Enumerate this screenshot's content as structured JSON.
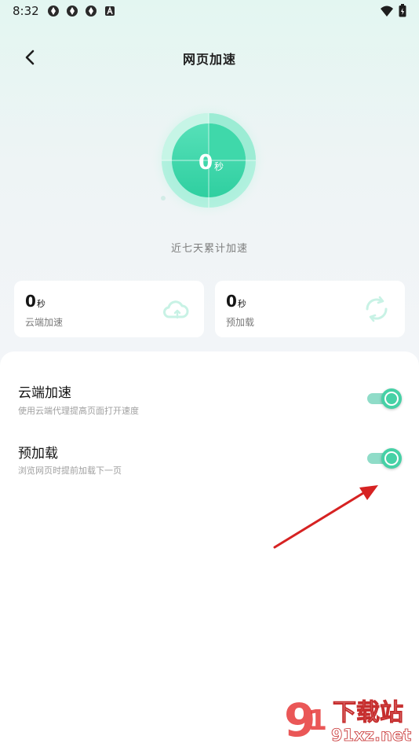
{
  "status_bar": {
    "time": "8:32",
    "icons": [
      "notification-icon",
      "notification-icon",
      "notification-icon",
      "a-icon"
    ],
    "right_icons": [
      "wifi-icon",
      "battery-icon"
    ]
  },
  "header": {
    "title": "网页加速",
    "back_icon": "back-arrow-icon"
  },
  "hero": {
    "value": "0",
    "unit": "秒",
    "caption": "近七天累计加速",
    "accent_color": "#2fd3a3"
  },
  "cards": [
    {
      "value": "0",
      "unit": "秒",
      "label": "云端加速",
      "icon": "cloud-icon"
    },
    {
      "value": "0",
      "unit": "秒",
      "label": "预加载",
      "icon": "refresh-icon"
    }
  ],
  "settings": [
    {
      "title": "云端加速",
      "description": "使用云端代理提高页面打开速度",
      "enabled": true
    },
    {
      "title": "预加载",
      "description": "浏览网页时提前加载下一页",
      "enabled": true
    }
  ],
  "watermark": {
    "brand": "下载站",
    "url": "91xz.net"
  },
  "colors": {
    "toggle_on": "#46d1a6",
    "annotation_arrow": "#d62222"
  }
}
